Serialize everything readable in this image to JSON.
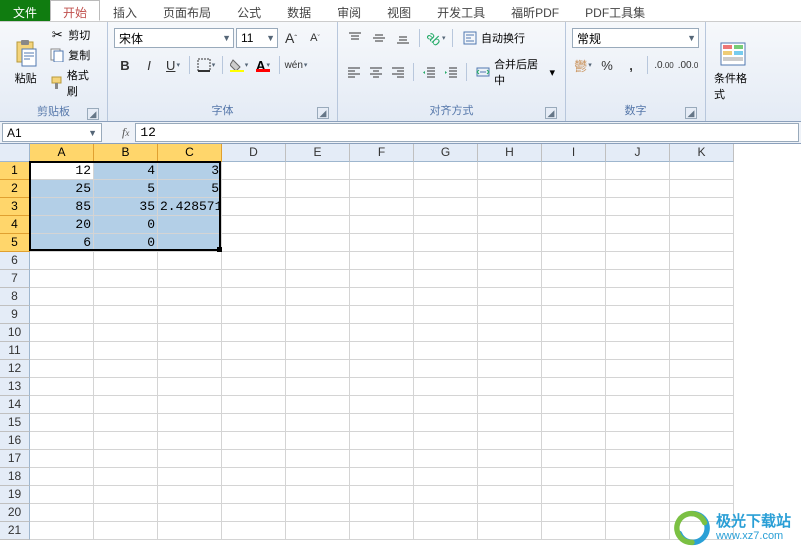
{
  "tabs": {
    "file": "文件",
    "home": "开始",
    "insert": "插入",
    "layout": "页面布局",
    "formulas": "公式",
    "data": "数据",
    "review": "审阅",
    "view": "视图",
    "dev": "开发工具",
    "foxit": "福昕PDF",
    "pdftools": "PDF工具集"
  },
  "clipboard": {
    "paste": "粘贴",
    "cut": "剪切",
    "copy": "复制",
    "format_painter": "格式刷",
    "label": "剪贴板"
  },
  "font": {
    "name": "宋体",
    "size": "11",
    "label": "字体"
  },
  "align": {
    "wrap": "自动换行",
    "merge": "合并后居中",
    "label": "对齐方式"
  },
  "number": {
    "format": "常规",
    "label": "数字"
  },
  "styles": {
    "cond": "条件格式"
  },
  "namebox": "A1",
  "formula": "12",
  "columns": [
    "A",
    "B",
    "C",
    "D",
    "E",
    "F",
    "G",
    "H",
    "I",
    "J",
    "K"
  ],
  "chart_data": {
    "type": "table",
    "columns": [
      "A",
      "B",
      "C"
    ],
    "rows": [
      {
        "A": 12,
        "B": 4,
        "C": 3
      },
      {
        "A": 25,
        "B": 5,
        "C": 5
      },
      {
        "A": 85,
        "B": 35,
        "C": 2.428571
      },
      {
        "A": 20,
        "B": 0,
        "C": ""
      },
      {
        "A": 6,
        "B": 0,
        "C": ""
      }
    ]
  },
  "selection": {
    "r1": 1,
    "c1": 1,
    "r2": 5,
    "c2": 3
  },
  "total_rows": 21,
  "watermark": {
    "title": "极光下载站",
    "url": "www.xz7.com"
  }
}
